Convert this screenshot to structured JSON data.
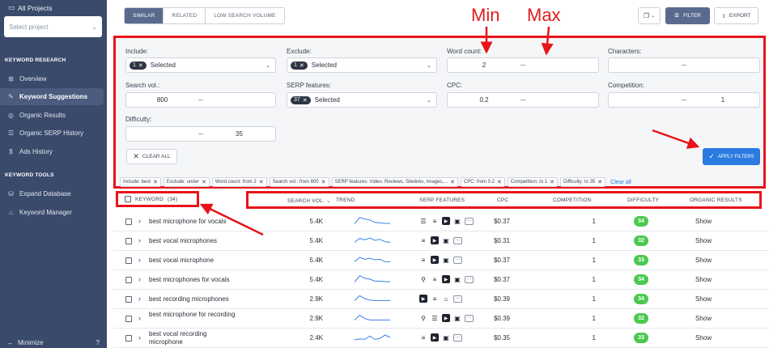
{
  "sidebar": {
    "projects_title": "All Projects",
    "select_project_placeholder": "Select project",
    "sections": {
      "keyword_research": "KEYWORD RESEARCH",
      "keyword_tools": "KEYWORD TOOLS"
    },
    "items": [
      {
        "label": "Overview",
        "icon": "grid-icon"
      },
      {
        "label": "Keyword Suggestions",
        "icon": "pencil-icon",
        "active": true
      },
      {
        "label": "Organic Results",
        "icon": "target-icon"
      },
      {
        "label": "Organic SERP History",
        "icon": "list-icon"
      },
      {
        "label": "Ads History",
        "icon": "dollar-icon"
      }
    ],
    "tools": [
      {
        "label": "Expand Database",
        "icon": "database-icon"
      },
      {
        "label": "Keyword Manager",
        "icon": "bank-icon"
      }
    ],
    "minimize": "Minimize",
    "help_icon": "question-icon"
  },
  "tabs": [
    "SIMILAR",
    "RELATED",
    "LOW SEARCH VOLUME"
  ],
  "toolbar": {
    "filter_label": "FILTER",
    "export_label": "EXPORT"
  },
  "annotations": {
    "min": "Min",
    "max": "Max"
  },
  "filters": {
    "include_label": "Include:",
    "include_count": "1",
    "include_value": "Selected",
    "exclude_label": "Exclude:",
    "exclude_count": "1",
    "exclude_value": "Selected",
    "word_count_label": "Word count:",
    "word_count_min": "2",
    "word_count_max": "",
    "characters_label": "Characters:",
    "search_vol_label": "Search vol.:",
    "search_vol_min": "800",
    "serp_label": "SERP features:",
    "serp_count": "37",
    "serp_value": "Selected",
    "cpc_label": "CPC:",
    "cpc_min": "0.2",
    "competition_label": "Competition:",
    "competition_max": "1",
    "difficulty_label": "Difficulty:",
    "difficulty_max": "35",
    "clear_all_label": "CLEAR ALL",
    "apply_label": "APPLY FILTERS",
    "tags": [
      "Include: best",
      "Exclude: under",
      "Word count: from 2",
      "Search vol.: from 800",
      "SERP features: Video, Reviews, Sitelinks, Images,...",
      "CPC: from 0.2",
      "Competition: to 1",
      "Difficulty: to 35"
    ],
    "clear_all_link": "Clear all"
  },
  "table": {
    "keyword_header": "KEYWORD",
    "keyword_count": "(34)",
    "columns": [
      "SEARCH VOL.",
      "TREND",
      "SERP FEATURES",
      "CPC",
      "COMPETITION",
      "DIFFICULTY",
      "ORGANIC RESULTS"
    ],
    "rows": [
      {
        "keyword": "best microphone for vocals",
        "vol": "5.4K",
        "cpc": "$0.37",
        "comp": "1",
        "diff": "34",
        "organic": "Show",
        "features": [
          "list-icon",
          "reviews-icon",
          "video-icon",
          "image-icon",
          "more-icon"
        ],
        "trend": [
          0.2,
          0.85,
          0.7,
          0.6,
          0.35,
          0.3,
          0.25,
          0.25
        ]
      },
      {
        "keyword": "best vocal microphones",
        "vol": "5.4K",
        "cpc": "$0.31",
        "comp": "1",
        "diff": "32",
        "organic": "Show",
        "features": [
          "reviews-icon",
          "video-icon",
          "image-icon",
          "more-icon"
        ],
        "trend": [
          0.3,
          0.7,
          0.55,
          0.75,
          0.5,
          0.6,
          0.35,
          0.3
        ]
      },
      {
        "keyword": "best vocal microphone",
        "vol": "5.4K",
        "cpc": "$0.37",
        "comp": "1",
        "diff": "33",
        "organic": "Show",
        "features": [
          "reviews-icon",
          "video-icon",
          "image-icon",
          "more-icon"
        ],
        "trend": [
          0.3,
          0.75,
          0.55,
          0.65,
          0.5,
          0.55,
          0.3,
          0.3
        ]
      },
      {
        "keyword": "best microphones for vocals",
        "vol": "5.4K",
        "cpc": "$0.37",
        "comp": "1",
        "diff": "34",
        "organic": "Show",
        "features": [
          "location-icon",
          "reviews-icon",
          "video-icon",
          "image-icon",
          "more-icon"
        ],
        "trend": [
          0.2,
          0.85,
          0.6,
          0.5,
          0.3,
          0.3,
          0.25,
          0.25
        ]
      },
      {
        "keyword": "best recording microphones",
        "vol": "2.9K",
        "cpc": "$0.39",
        "comp": "1",
        "diff": "34",
        "organic": "Show",
        "features": [
          "video-icon",
          "reviews-icon",
          "basket-icon",
          "more-icon"
        ],
        "trend": [
          0.3,
          0.8,
          0.5,
          0.35,
          0.3,
          0.3,
          0.3,
          0.3
        ]
      },
      {
        "keyword": "best microphone for recording",
        "vol": "2.9K",
        "cpc": "$0.39",
        "comp": "1",
        "diff": "32",
        "organic": "Show",
        "features": [
          "location-icon",
          "list-icon",
          "video-icon",
          "image-icon",
          "more-icon"
        ],
        "trend": [
          0.3,
          0.8,
          0.45,
          0.3,
          0.3,
          0.3,
          0.3,
          0.3
        ]
      },
      {
        "keyword": "best vocal recording microphone",
        "vol": "2.4K",
        "cpc": "$0.35",
        "comp": "1",
        "diff": "33",
        "organic": "Show",
        "features": [
          "reviews-icon",
          "video-icon",
          "image-icon",
          "more-icon"
        ],
        "trend": [
          0.25,
          0.35,
          0.3,
          0.65,
          0.3,
          0.4,
          0.75,
          0.5
        ]
      }
    ]
  }
}
